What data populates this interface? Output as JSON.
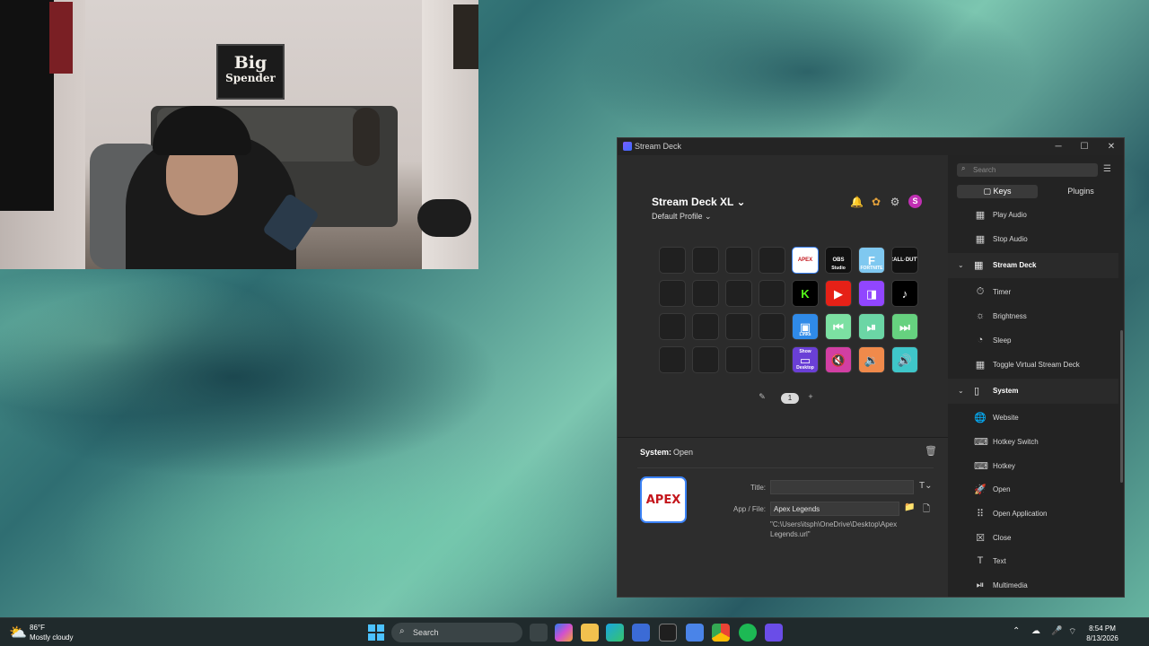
{
  "window": {
    "title": "Stream Deck",
    "min_glyph": "─",
    "max_glyph": "☐",
    "close_glyph": "✕"
  },
  "header": {
    "device_name": "Stream Deck XL",
    "device_chevron": "⌄",
    "profile_name": "Default Profile",
    "profile_chevron": "⌄",
    "avatar_letter": "S"
  },
  "keys": [
    {
      "type": "empty"
    },
    {
      "type": "empty"
    },
    {
      "type": "empty"
    },
    {
      "type": "empty"
    },
    {
      "type": "app",
      "name": "apex-legends",
      "text": "APEX",
      "bg": "#ffffff",
      "fg": "#c4161c",
      "border": "#3b82f6"
    },
    {
      "type": "app",
      "name": "obs-studio",
      "text": "OBS",
      "caption": "Studio",
      "bg": "#111111",
      "fg": "#ffffff"
    },
    {
      "type": "app",
      "name": "fortnite",
      "text": "F",
      "caption": "FORTNITE",
      "bg": "#7fc8f0",
      "fg": "#ffffff"
    },
    {
      "type": "app",
      "name": "call-of-duty",
      "text": "CALL·DUTY",
      "bg": "#111111",
      "fg": "#ffffff"
    },
    {
      "type": "empty"
    },
    {
      "type": "empty"
    },
    {
      "type": "empty"
    },
    {
      "type": "empty"
    },
    {
      "type": "app",
      "name": "kick",
      "text": "K",
      "bg": "#000000",
      "fg": "#53fc18"
    },
    {
      "type": "app",
      "name": "youtube",
      "text": "▶",
      "bg": "#e62117",
      "fg": "#ffffff"
    },
    {
      "type": "app",
      "name": "twitch",
      "text": "◨",
      "bg": "#9146ff",
      "fg": "#ffffff"
    },
    {
      "type": "app",
      "name": "tiktok",
      "text": "♪",
      "bg": "#000000",
      "fg": "#ffffff"
    },
    {
      "type": "empty"
    },
    {
      "type": "empty"
    },
    {
      "type": "empty"
    },
    {
      "type": "empty"
    },
    {
      "type": "app",
      "name": "links",
      "text": "▣",
      "caption": "Links",
      "bg": "#2f8ae8",
      "fg": "#ffffff"
    },
    {
      "type": "app",
      "name": "previous-track",
      "text": "⏮",
      "bg": "#7ce0a2",
      "fg": "#ffffff"
    },
    {
      "type": "app",
      "name": "play-pause",
      "text": "⏯",
      "bg": "#6bd6a5",
      "fg": "#ffffff"
    },
    {
      "type": "app",
      "name": "next-track",
      "text": "⏭",
      "bg": "#66d17f",
      "fg": "#ffffff"
    },
    {
      "type": "empty"
    },
    {
      "type": "empty"
    },
    {
      "type": "empty"
    },
    {
      "type": "empty"
    },
    {
      "type": "app",
      "name": "show-desktop",
      "text": "▭",
      "topcaption": "Show",
      "caption": "Desktop",
      "bg": "#6a3fd6",
      "fg": "#ffffff"
    },
    {
      "type": "app",
      "name": "mute",
      "text": "🔇",
      "bg": "#d23fa3",
      "fg": "#ffffff"
    },
    {
      "type": "app",
      "name": "volume-down",
      "text": "🔉",
      "bg": "#f08a4b",
      "fg": "#ffffff"
    },
    {
      "type": "app",
      "name": "volume-up",
      "text": "🔊",
      "bg": "#3fc6c9",
      "fg": "#ffffff"
    }
  ],
  "pager": {
    "pin": "✎",
    "page": "1",
    "add": "+"
  },
  "properties": {
    "category_label": "System:",
    "action_label": "Open",
    "preview_text": "APEX",
    "title_label": "Title:",
    "title_value": "",
    "title_format_glyph": "T⌄",
    "app_file_label": "App / File:",
    "app_file_value": "Apex Legends",
    "path_text": "\"C:\\Users\\itsph\\OneDrive\\Desktop\\Apex Legends.url\""
  },
  "actions": {
    "search_placeholder": "Search",
    "tab_keys": "Keys",
    "tab_plugins": "Plugins",
    "items_top": [
      {
        "label": "Play Audio",
        "icon": "▦"
      },
      {
        "label": "Stop Audio",
        "icon": "▦"
      }
    ],
    "cat_streamdeck": "Stream Deck",
    "items_sd": [
      {
        "label": "Timer",
        "icon": "⏱"
      },
      {
        "label": "Brightness",
        "icon": "☼"
      },
      {
        "label": "Sleep",
        "icon": "◔"
      },
      {
        "label": "Toggle Virtual Stream Deck",
        "icon": "▦"
      }
    ],
    "cat_system": "System",
    "items_sys": [
      {
        "label": "Website",
        "icon": "🌐"
      },
      {
        "label": "Hotkey Switch",
        "icon": "⌨"
      },
      {
        "label": "Hotkey",
        "icon": "⌨"
      },
      {
        "label": "Open",
        "icon": "🚀"
      },
      {
        "label": "Open Application",
        "icon": "⠿"
      },
      {
        "label": "Close",
        "icon": "☒"
      },
      {
        "label": "Text",
        "icon": "T"
      },
      {
        "label": "Multimedia",
        "icon": "⏯"
      }
    ]
  },
  "webcam": {
    "sign_line1": "Big",
    "sign_line2": "Spender"
  },
  "taskbar": {
    "temp": "86°F",
    "condition": "Mostly cloudy",
    "search_label": "Search",
    "time": "8:54 PM",
    "date": "8/13/2026"
  }
}
